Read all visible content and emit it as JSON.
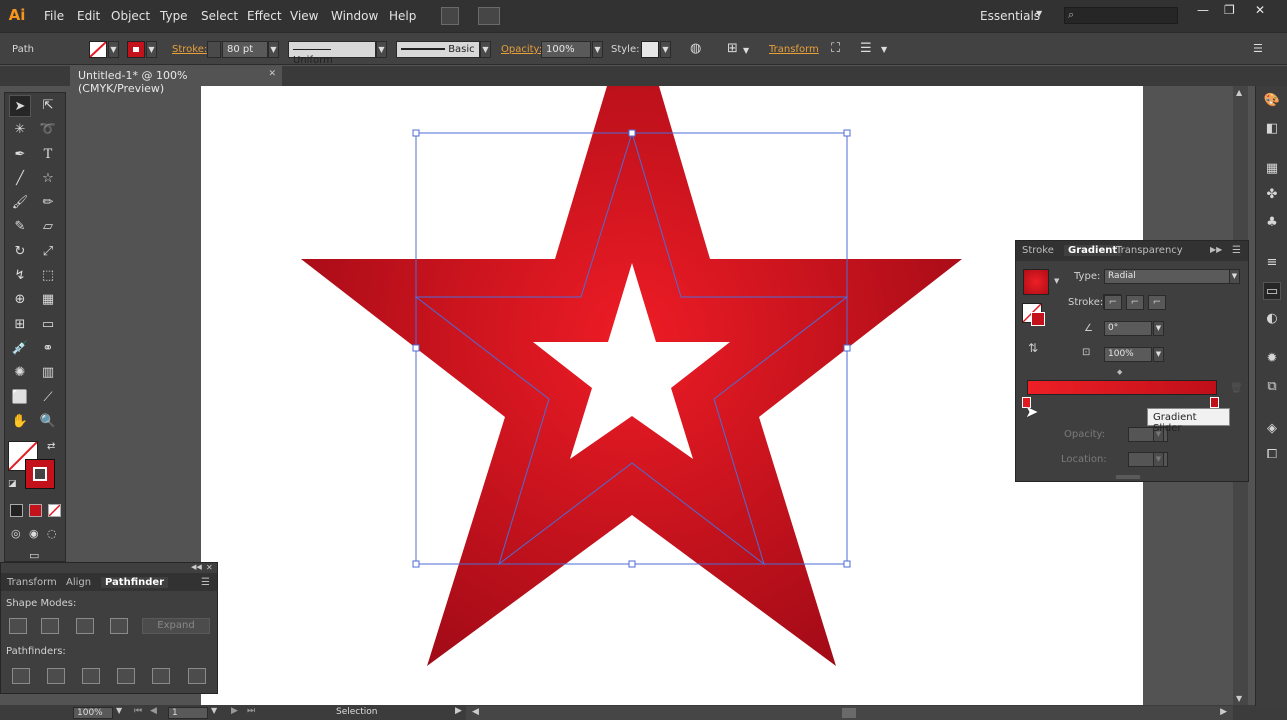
{
  "app": {
    "logo": "Ai",
    "menu": [
      "File",
      "Edit",
      "Object",
      "Type",
      "Select",
      "Effect",
      "View",
      "Window",
      "Help"
    ],
    "workspace": "Essentials",
    "window_controls": [
      "—",
      "❐",
      "✕"
    ]
  },
  "control_bar": {
    "object_type": "Path",
    "stroke_label": "Stroke:",
    "stroke_weight": "80 pt",
    "stroke_profile": "Uniform",
    "brush": "Basic",
    "opacity_label": "Opacity:",
    "opacity_value": "100%",
    "style_label": "Style:",
    "transform_label": "Transform"
  },
  "document": {
    "tab_title": "Untitled-1* @ 100% (CMYK/Preview)",
    "tab_close": "✕"
  },
  "gradient_panel": {
    "tabs": [
      "Stroke",
      "Gradient",
      "Transparency"
    ],
    "active_tab": "Gradient",
    "type_label": "Type:",
    "type_value": "Radial",
    "stroke_label": "Stroke:",
    "angle_value": "0°",
    "aspect_value": "100%",
    "opacity_label": "Opacity:",
    "location_label": "Location:",
    "tooltip": "Gradient Slider",
    "colors": {
      "start": "#ee1f26",
      "end": "#c00f19"
    }
  },
  "pathfinder_panel": {
    "tabs": [
      "Transform",
      "Align",
      "Pathfinder"
    ],
    "active_tab": "Pathfinder",
    "shape_modes_label": "Shape Modes:",
    "expand_label": "Expand",
    "pathfinders_label": "Pathfinders:"
  },
  "status_bar": {
    "zoom": "100%",
    "artboard_number": "1",
    "tool_name": "Selection"
  },
  "artwork": {
    "star_gradient_center": "#ee1c25",
    "star_gradient_edge": "#9e0a16",
    "selection_color": "#4d6cd6"
  }
}
